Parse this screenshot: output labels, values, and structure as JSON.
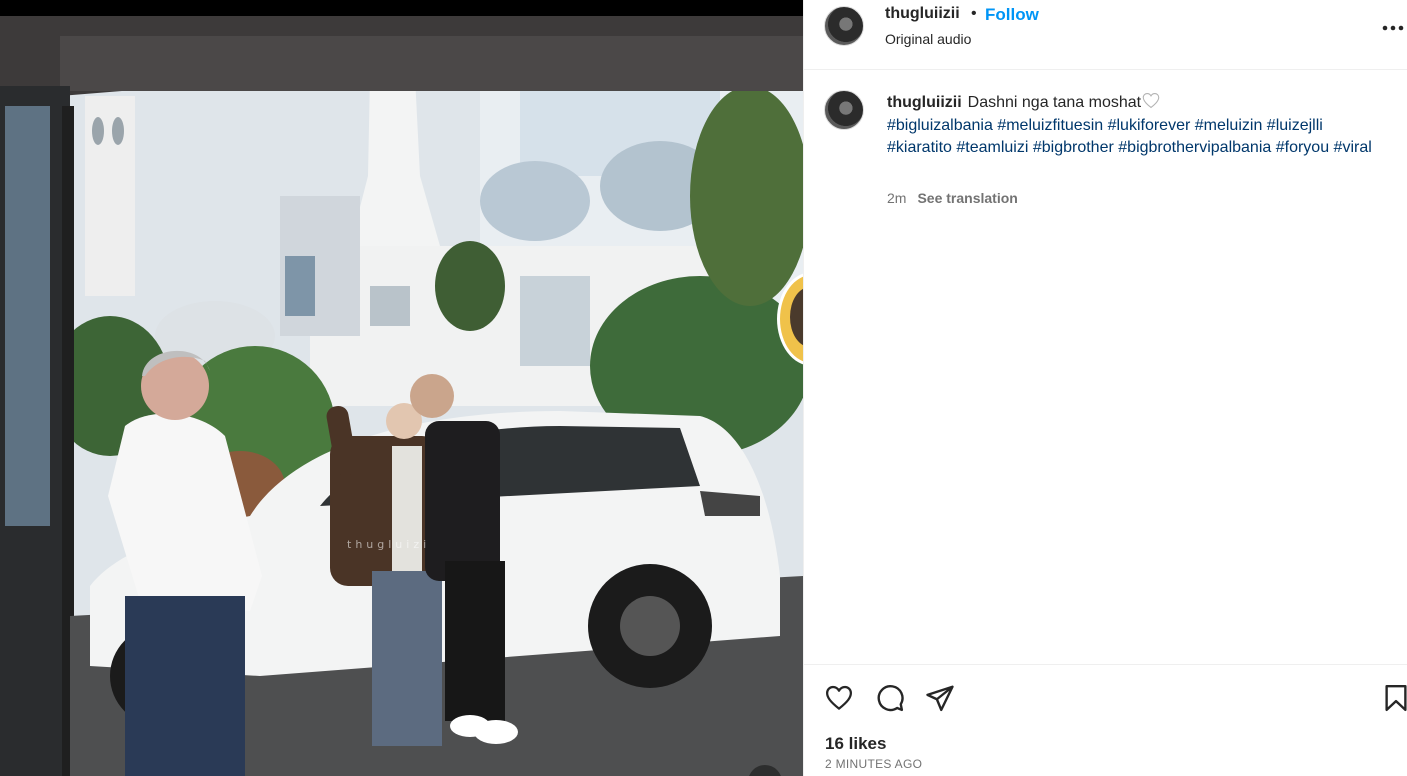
{
  "post": {
    "username": "thugluiizii",
    "separator": "•",
    "follow_label": "Follow",
    "audio_label": "Original audio",
    "more_label": "•••"
  },
  "caption": {
    "username": "thugluiizii",
    "text": "Dashni nga tana moshat",
    "hashtags": [
      "#bigluizalbania",
      "#meluizfituesin",
      "#lukiforever",
      "#meluizin",
      "#luizejlli",
      "#kiaratito",
      "#teamluizi",
      "#bigbrother",
      "#bigbrothervipalbania",
      "#foryou",
      "#viral"
    ],
    "age": "2m",
    "see_translation": "See translation"
  },
  "media": {
    "watermark": "thugluizi"
  },
  "engagement": {
    "likes": "16 likes",
    "time": "2 MINUTES AGO"
  },
  "icons": {
    "like": "heart-icon",
    "comment": "comment-icon",
    "share": "send-icon",
    "save": "bookmark-icon",
    "more": "more-options-icon"
  },
  "colors": {
    "follow": "#0095f6",
    "hashtag": "#00376b",
    "muted": "#737373"
  }
}
